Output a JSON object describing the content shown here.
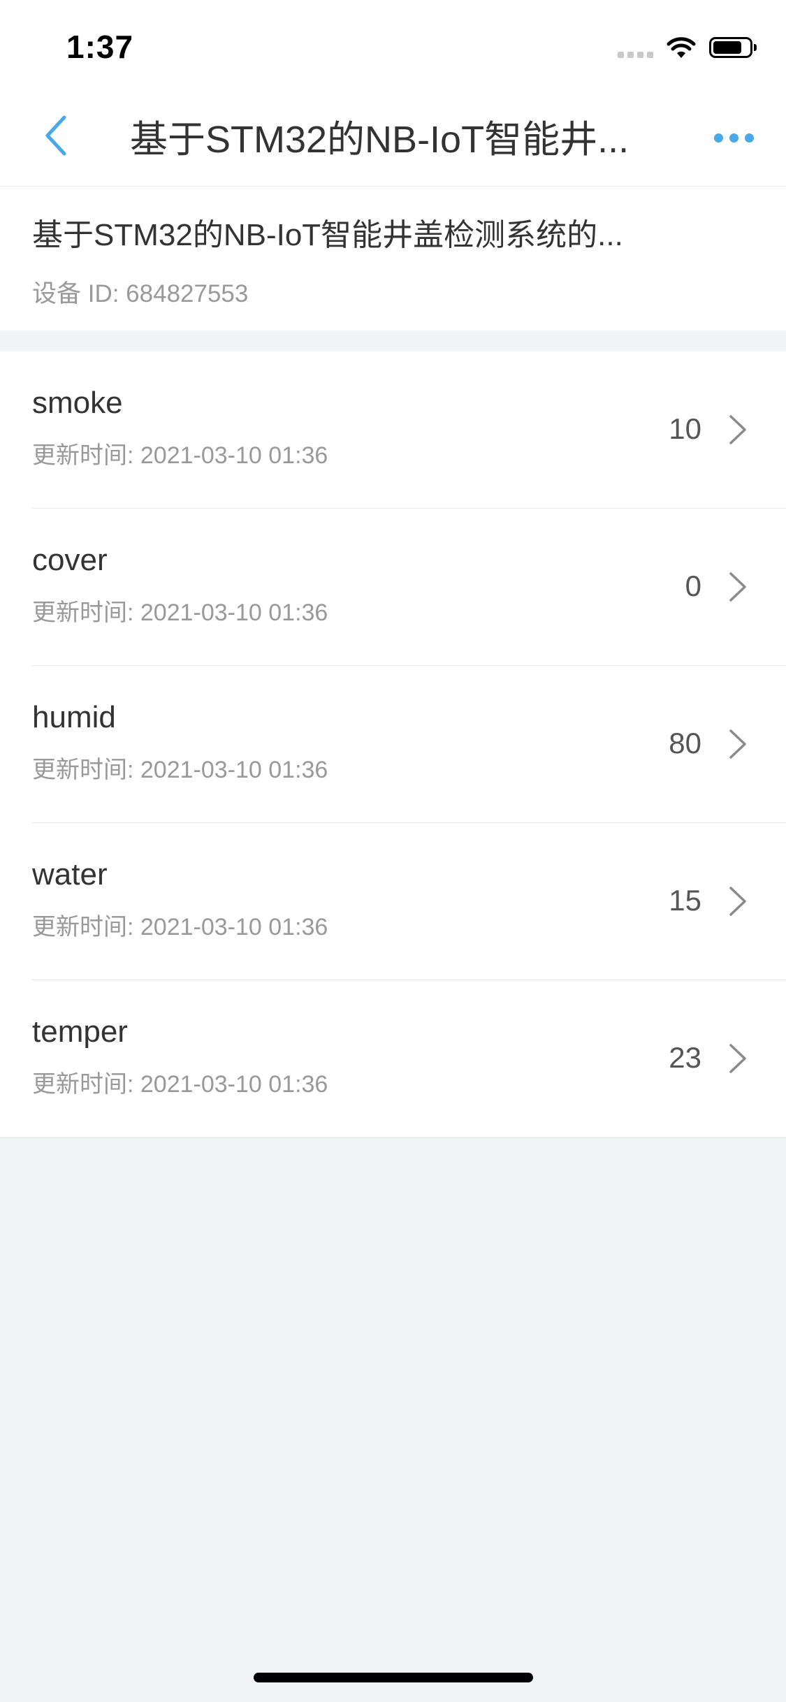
{
  "status_bar": {
    "time": "1:37",
    "icons": [
      "signal-icon",
      "wifi-icon",
      "battery-icon"
    ]
  },
  "nav": {
    "back_icon": "chevron-left-icon",
    "title": "基于STM32的NB-IoT智能井...",
    "more_icon": "more-dots-icon",
    "accent_color": "#4aa8e8"
  },
  "device": {
    "name": "基于STM32的NB-IoT智能井盖检测系统的...",
    "id_text": "设备 ID: 684827553"
  },
  "streams": [
    {
      "name": "smoke",
      "time": "更新时间: 2021-03-10 01:36",
      "value": "10"
    },
    {
      "name": "cover",
      "time": "更新时间: 2021-03-10 01:36",
      "value": "0"
    },
    {
      "name": "humid",
      "time": "更新时间: 2021-03-10 01:36",
      "value": "80"
    },
    {
      "name": "water",
      "time": "更新时间: 2021-03-10 01:36",
      "value": "15"
    },
    {
      "name": "temper",
      "time": "更新时间: 2021-03-10 01:36",
      "value": "23"
    }
  ]
}
